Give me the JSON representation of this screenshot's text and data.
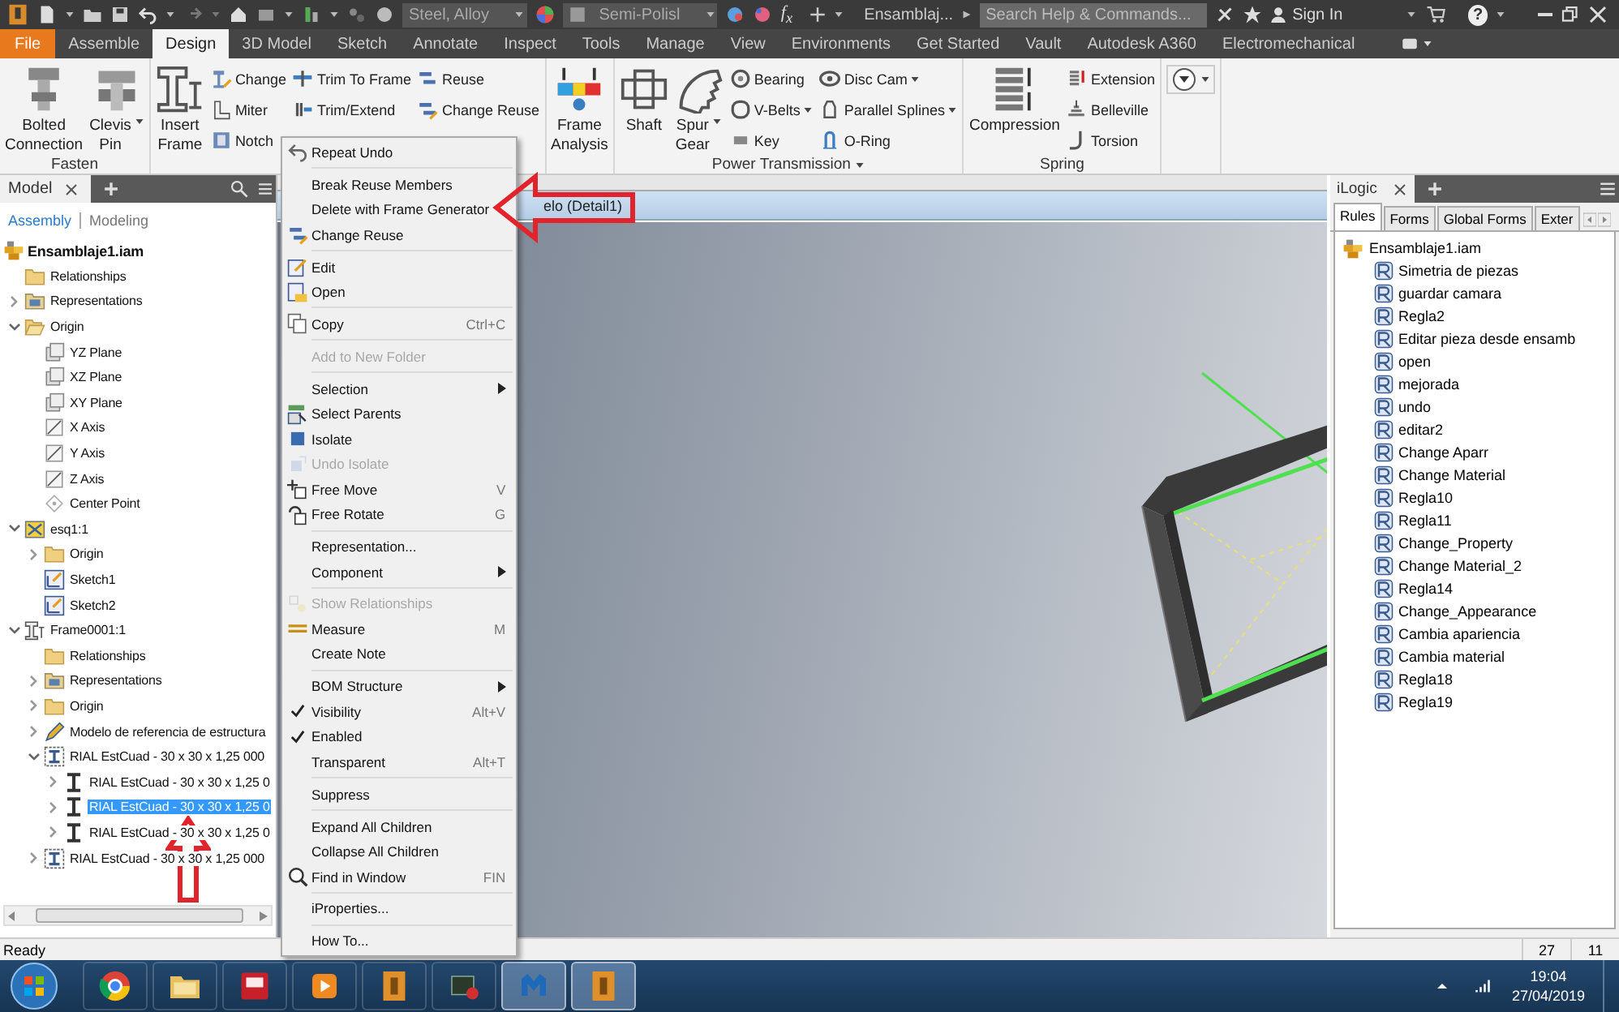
{
  "titlebar": {
    "material": "Steel, Alloy",
    "appearance": "Semi-Polisl",
    "formula": "f$_{x}$",
    "document": "Ensamblaj...",
    "search": {
      "placeholder": "Search Help & Commands..."
    },
    "sign_in": "Sign In",
    "help": "?"
  },
  "menu_tabs": [
    {
      "label": "File",
      "kind": "app-menu",
      "selected": false
    },
    {
      "label": "Assemble",
      "kind": "tab",
      "selected": false
    },
    {
      "label": "Design",
      "kind": "tab",
      "selected": true
    },
    {
      "label": "3D Model",
      "kind": "tab",
      "selected": false
    },
    {
      "label": "Sketch",
      "kind": "tab",
      "selected": false
    },
    {
      "label": "Annotate",
      "kind": "tab",
      "selected": false
    },
    {
      "label": "Inspect",
      "kind": "tab",
      "selected": false
    },
    {
      "label": "Tools",
      "kind": "tab",
      "selected": false
    },
    {
      "label": "Manage",
      "kind": "tab",
      "selected": false
    },
    {
      "label": "View",
      "kind": "tab",
      "selected": false
    },
    {
      "label": "Environments",
      "kind": "tab",
      "selected": false
    },
    {
      "label": "Get Started",
      "kind": "tab",
      "selected": false
    },
    {
      "label": "Vault",
      "kind": "tab",
      "selected": false
    },
    {
      "label": "Autodesk A360",
      "kind": "tab",
      "selected": false
    },
    {
      "label": "Electromechanical",
      "kind": "tab",
      "selected": false
    }
  ],
  "ribbon": {
    "panels": [
      {
        "label": "Fasten",
        "label_dropdown": false,
        "groups": [
          {
            "kind": "large",
            "label": "Bolted Connection",
            "dropdown": false
          },
          {
            "kind": "large",
            "label": "Clevis Pin",
            "dropdown": true
          }
        ]
      },
      {
        "groups": [
          {
            "kind": "large",
            "label": "Insert Frame",
            "dropdown": false
          },
          {
            "kind": "column",
            "tools": [
              {
                "label": "Change",
                "dropdown": false
              },
              {
                "label": "Miter",
                "dropdown": false
              },
              {
                "label": "Notch",
                "dropdown": false
              }
            ]
          },
          {
            "kind": "column",
            "tools": [
              {
                "label": "Trim To Frame",
                "dropdown": false
              },
              {
                "label": "Trim/Extend",
                "dropdown": false
              }
            ]
          },
          {
            "kind": "column",
            "tools": [
              {
                "label": "Reuse",
                "dropdown": false
              },
              {
                "label": "Change Reuse",
                "dropdown": false
              }
            ]
          }
        ]
      },
      {
        "groups": [
          {
            "kind": "large",
            "label": "Frame Analysis",
            "dropdown": false
          }
        ]
      },
      {
        "label": "Power Transmission",
        "label_dropdown": true,
        "groups": [
          {
            "kind": "large",
            "label": "Shaft",
            "dropdown": false
          },
          {
            "kind": "large",
            "label": "Spur Gear",
            "dropdown": true
          },
          {
            "kind": "column",
            "tools": [
              {
                "label": "Bearing",
                "dropdown": false
              },
              {
                "label": "V-Belts",
                "dropdown": true
              },
              {
                "label": "Key",
                "dropdown": false
              }
            ]
          },
          {
            "kind": "column",
            "tools": [
              {
                "label": "Disc Cam",
                "dropdown": true
              },
              {
                "label": "Parallel Splines",
                "dropdown": true
              },
              {
                "label": "O-Ring",
                "dropdown": false
              }
            ]
          }
        ]
      },
      {
        "label": "Spring",
        "label_dropdown": false,
        "groups": [
          {
            "kind": "large",
            "label": "Compression",
            "dropdown": false
          },
          {
            "kind": "column",
            "tools": [
              {
                "label": "Extension",
                "dropdown": false
              },
              {
                "label": "Belleville",
                "dropdown": false
              },
              {
                "label": "Torsion",
                "dropdown": false
              }
            ]
          }
        ]
      },
      {
        "groups": [
          {
            "kind": "icon",
            "dropdown": true
          }
        ]
      }
    ]
  },
  "browser": {
    "title": "Model",
    "modes": [
      {
        "label": "Assembly",
        "selected": true
      },
      {
        "label": "Modeling",
        "selected": false
      }
    ],
    "tree": [
      {
        "label": "Ensamblaje1.iam",
        "kind": "assembly",
        "selected": false,
        "children": [
          {
            "label": "Relationships",
            "kind": "folder",
            "selected": false
          },
          {
            "label": "Representations",
            "kind": "representations",
            "expanded": false,
            "selected": false
          },
          {
            "label": "Origin",
            "kind": "open-folder",
            "expanded": true,
            "selected": false,
            "children": [
              {
                "label": "YZ Plane",
                "kind": "plane",
                "selected": false
              },
              {
                "label": "XZ Plane",
                "kind": "plane",
                "selected": false
              },
              {
                "label": "XY Plane",
                "kind": "plane",
                "selected": false
              },
              {
                "label": "X Axis",
                "kind": "axis",
                "selected": false
              },
              {
                "label": "Y Axis",
                "kind": "axis",
                "selected": false
              },
              {
                "label": "Z Axis",
                "kind": "axis",
                "selected": false
              },
              {
                "label": "Center Point",
                "kind": "point",
                "selected": false
              }
            ]
          },
          {
            "label": "esq1:1",
            "kind": "part",
            "expanded": true,
            "selected": false,
            "children": [
              {
                "label": "Origin",
                "kind": "folder",
                "expanded": false,
                "selected": false
              },
              {
                "label": "Sketch1",
                "kind": "sketch",
                "selected": false
              },
              {
                "label": "Sketch2",
                "kind": "sketch",
                "selected": false
              }
            ]
          },
          {
            "label": "Frame0001:1",
            "kind": "frame",
            "expanded": true,
            "selected": false,
            "children": [
              {
                "label": "Relationships",
                "kind": "folder",
                "selected": false
              },
              {
                "label": "Representations",
                "kind": "representations",
                "expanded": false,
                "selected": false
              },
              {
                "label": "Origin",
                "kind": "folder",
                "expanded": false,
                "selected": false
              },
              {
                "label": "Modelo de referencia de estructura",
                "kind": "reference",
                "expanded": false,
                "selected": false
              },
              {
                "label": "RIAL EstCuad - 30 x 30 x 1,25 000",
                "kind": "member-group",
                "expanded": true,
                "selected": false,
                "children": [
                  {
                    "label": "RIAL EstCuad - 30 x 30 x 1,25 0",
                    "kind": "member",
                    "expanded": false,
                    "selected": false
                  },
                  {
                    "label": "RIAL EstCuad - 30 x 30 x 1,25 0",
                    "kind": "member",
                    "expanded": false,
                    "selected": true
                  },
                  {
                    "label": "RIAL EstCuad - 30 x 30 x 1,25 0",
                    "kind": "member",
                    "expanded": false,
                    "selected": false
                  }
                ]
              },
              {
                "label": "RIAL EstCuad - 30 x 30 x 1,25 000",
                "kind": "member-group",
                "expanded": false,
                "selected": false
              }
            ]
          }
        ]
      }
    ]
  },
  "viewport": {
    "tab": "elo (Detail1)"
  },
  "ilogic": {
    "title": "iLogic",
    "tabs": [
      {
        "label": "Rules",
        "selected": true
      },
      {
        "label": "Forms",
        "selected": false
      },
      {
        "label": "Global Forms",
        "selected": false
      },
      {
        "label": "Exter",
        "selected": false
      }
    ],
    "root": "Ensamblaje1.iam",
    "rules": [
      {
        "label": "Simetria de piezas",
        "selected": false
      },
      {
        "label": "guardar camara",
        "selected": false
      },
      {
        "label": "Regla2",
        "selected": false
      },
      {
        "label": "Editar pieza desde ensamb",
        "selected": false
      },
      {
        "label": "open",
        "selected": false
      },
      {
        "label": "mejorada",
        "selected": false
      },
      {
        "label": "undo",
        "selected": false
      },
      {
        "label": "editar2",
        "selected": false
      },
      {
        "label": "Change Aparr",
        "selected": false
      },
      {
        "label": "Change Material",
        "selected": false
      },
      {
        "label": "Regla10",
        "selected": false
      },
      {
        "label": "Regla11",
        "selected": false
      },
      {
        "label": "Change_Property",
        "selected": false
      },
      {
        "label": "Change Material_2",
        "selected": false
      },
      {
        "label": "Regla14",
        "selected": false
      },
      {
        "label": "Change_Appearance",
        "selected": false
      },
      {
        "label": "Cambia apariencia",
        "selected": false
      },
      {
        "label": "Cambia material",
        "selected": false
      },
      {
        "label": "Regla18",
        "selected": false
      },
      {
        "label": "Regla19",
        "selected": false
      }
    ]
  },
  "context_menu": {
    "groups": [
      [
        {
          "label": "Repeat Undo",
          "checked": false,
          "disabled": false,
          "submenu": false
        }
      ],
      [
        {
          "label": "Break Reuse Members",
          "checked": false,
          "disabled": false,
          "submenu": false
        },
        {
          "label": "Delete with Frame Generator",
          "checked": false,
          "disabled": false,
          "submenu": false
        },
        {
          "label": "Change Reuse",
          "checked": false,
          "disabled": false,
          "submenu": false
        }
      ],
      [
        {
          "label": "Edit",
          "checked": false,
          "disabled": false,
          "submenu": false
        },
        {
          "label": "Open",
          "checked": false,
          "disabled": false,
          "submenu": false
        }
      ],
      [
        {
          "label": "Copy",
          "shortcut": "Ctrl+C",
          "checked": false,
          "disabled": false,
          "submenu": false
        }
      ],
      [
        {
          "label": "Add to New Folder",
          "checked": false,
          "disabled": true,
          "submenu": false
        }
      ],
      [
        {
          "label": "Selection",
          "checked": false,
          "disabled": false,
          "submenu": true
        },
        {
          "label": "Select Parents",
          "checked": false,
          "disabled": false,
          "submenu": false
        },
        {
          "label": "Isolate",
          "checked": false,
          "disabled": false,
          "submenu": false
        },
        {
          "label": "Undo Isolate",
          "checked": false,
          "disabled": true,
          "submenu": false
        },
        {
          "label": "Free Move",
          "shortcut": "V",
          "checked": false,
          "disabled": false,
          "submenu": false
        },
        {
          "label": "Free Rotate",
          "shortcut": "G",
          "checked": false,
          "disabled": false,
          "submenu": false
        }
      ],
      [
        {
          "label": "Representation...",
          "checked": false,
          "disabled": false,
          "submenu": false
        },
        {
          "label": "Component",
          "checked": false,
          "disabled": false,
          "submenu": true
        }
      ],
      [
        {
          "label": "Show Relationships",
          "checked": false,
          "disabled": true,
          "submenu": false
        },
        {
          "label": "Measure",
          "shortcut": "M",
          "checked": false,
          "disabled": false,
          "submenu": false
        },
        {
          "label": "Create Note",
          "checked": false,
          "disabled": false,
          "submenu": false
        }
      ],
      [
        {
          "label": "BOM Structure",
          "checked": false,
          "disabled": false,
          "submenu": true
        },
        {
          "label": "Visibility",
          "shortcut": "Alt+V",
          "checked": true,
          "disabled": false,
          "submenu": false
        },
        {
          "label": "Enabled",
          "checked": true,
          "disabled": false,
          "submenu": false
        },
        {
          "label": "Transparent",
          "shortcut": "Alt+T",
          "checked": false,
          "disabled": false,
          "submenu": false
        }
      ],
      [
        {
          "label": "Suppress",
          "checked": false,
          "disabled": false,
          "submenu": false
        }
      ],
      [
        {
          "label": "Expand All Children",
          "checked": false,
          "disabled": false,
          "submenu": false
        },
        {
          "label": "Collapse All Children",
          "checked": false,
          "disabled": false,
          "submenu": false
        },
        {
          "label": "Find in Window",
          "shortcut": "FIN",
          "checked": false,
          "disabled": false,
          "submenu": false
        }
      ],
      [
        {
          "label": "iProperties...",
          "checked": false,
          "disabled": false,
          "submenu": false
        }
      ],
      [
        {
          "label": "How To...",
          "checked": false,
          "disabled": false,
          "submenu": false
        }
      ]
    ]
  },
  "status_bar": {
    "text": "Ready",
    "cells": [
      "27",
      "11"
    ]
  },
  "taskbar": {
    "apps": [
      {
        "kind": "browser",
        "active": false
      },
      {
        "kind": "folder",
        "active": false
      },
      {
        "kind": "cad",
        "active": false
      },
      {
        "kind": "media",
        "active": false
      },
      {
        "kind": "inventor",
        "active": false
      },
      {
        "kind": "terminal",
        "active": false
      },
      {
        "kind": "shield",
        "active": true
      },
      {
        "kind": "inventor",
        "active": true
      }
    ],
    "time": "19:04",
    "date": "27/04/2019"
  }
}
